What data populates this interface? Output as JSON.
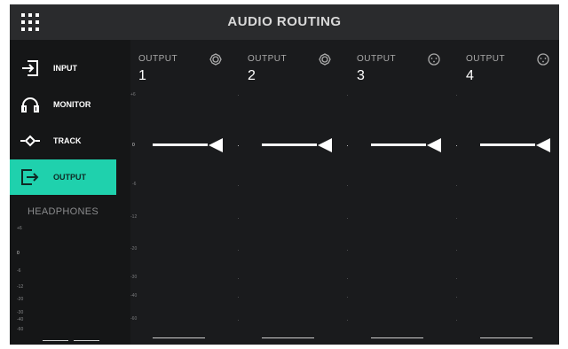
{
  "header": {
    "title": "AUDIO ROUTING",
    "menu_icon": "grid-menu-icon"
  },
  "sidebar": {
    "items": [
      {
        "label": "INPUT",
        "icon": "input-icon",
        "active": false
      },
      {
        "label": "MONITOR",
        "icon": "headphones-icon",
        "active": false
      },
      {
        "label": "TRACK",
        "icon": "track-icon",
        "active": false
      },
      {
        "label": "OUTPUT",
        "icon": "output-icon",
        "active": true
      }
    ],
    "headphones": {
      "title": "HEADPHONES",
      "scale": [
        "+6",
        "0",
        "-6",
        "-12",
        "-20",
        "-30",
        "-40",
        "-60"
      ]
    }
  },
  "outputs": [
    {
      "label": "OUTPUT",
      "number": "1",
      "icon": "speaker-icon",
      "level_db": 0
    },
    {
      "label": "OUTPUT",
      "number": "2",
      "icon": "speaker-icon",
      "level_db": 0
    },
    {
      "label": "OUTPUT",
      "number": "3",
      "icon": "xlr-icon",
      "level_db": 0
    },
    {
      "label": "OUTPUT",
      "number": "4",
      "icon": "xlr-icon",
      "level_db": 0
    }
  ],
  "scale": [
    "+6",
    "0",
    "-6",
    "-12",
    "-20",
    "-30",
    "-40",
    "-60"
  ],
  "colors": {
    "accent": "#1fd1ad",
    "background": "#1a1b1d",
    "topbar": "#2a2b2d",
    "sidebar": "#151617"
  }
}
